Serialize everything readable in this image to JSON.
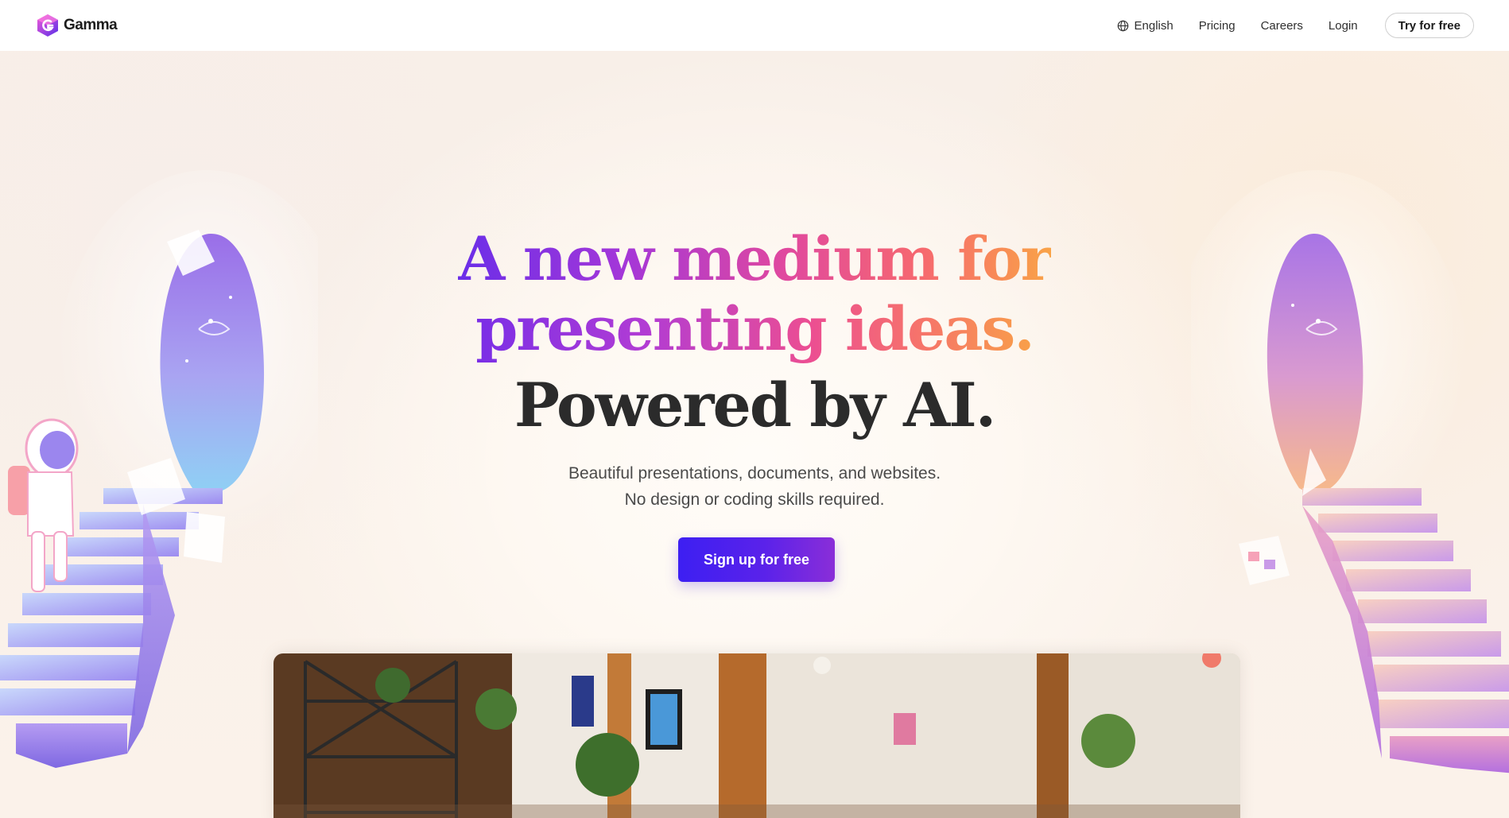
{
  "nav": {
    "brand": "Gamma",
    "language": "English",
    "links": [
      "Pricing",
      "Careers",
      "Login"
    ],
    "cta": "Try for free"
  },
  "hero": {
    "headline_line1_a": "A new ",
    "headline_line1_b": "medium for",
    "headline_line2": "presenting ideas.",
    "headline_line3": "Powered by AI.",
    "subtitle_line1": "Beautiful presentations, documents, and websites.",
    "subtitle_line2": "No design or coding skills required.",
    "cta": "Sign up for free"
  },
  "colors": {
    "accent_purple": "#4a20ee",
    "gradient_start": "#6a2ee8",
    "gradient_mid": "#e0489f",
    "gradient_end": "#f9a347",
    "background": "#fbf3ec"
  },
  "icons": {
    "logo": "gamma-logo-icon",
    "language": "globe-icon"
  }
}
